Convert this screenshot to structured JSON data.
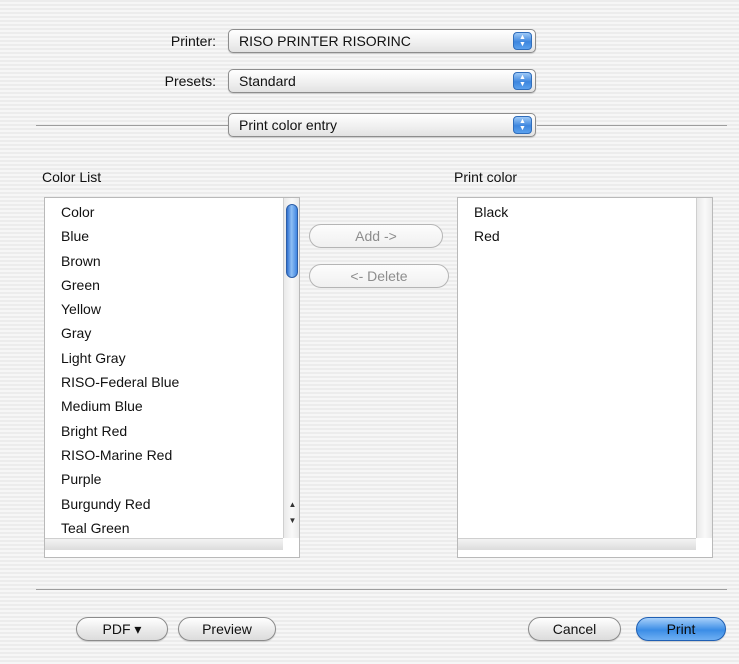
{
  "printer": {
    "label": "Printer:",
    "value": "RISO PRINTER RISORINC"
  },
  "presets": {
    "label": "Presets:",
    "value": "Standard"
  },
  "panel": {
    "value": "Print color entry"
  },
  "color_list": {
    "title": "Color List",
    "items": [
      "Color",
      "Blue",
      "Brown",
      "Green",
      "Yellow",
      "Gray",
      "Light Gray",
      "RISO-Federal Blue",
      "Medium Blue",
      "Bright Red",
      "RISO-Marine Red",
      "Purple",
      "Burgundy Red",
      "Teal Green"
    ]
  },
  "print_color": {
    "title": "Print color",
    "items": [
      "Black",
      "Red"
    ]
  },
  "actions": {
    "add": "Add ->",
    "delete": "<- Delete"
  },
  "footer": {
    "pdf": "PDF ▾",
    "preview": "Preview",
    "cancel": "Cancel",
    "print": "Print"
  },
  "icons": {
    "popup_arrows": "updown-arrows-icon",
    "scroll_up": "scroll-up-arrow-icon",
    "scroll_down": "scroll-down-arrow-icon"
  },
  "colors": {
    "accent": "#3d86de",
    "background": "#ececec"
  }
}
